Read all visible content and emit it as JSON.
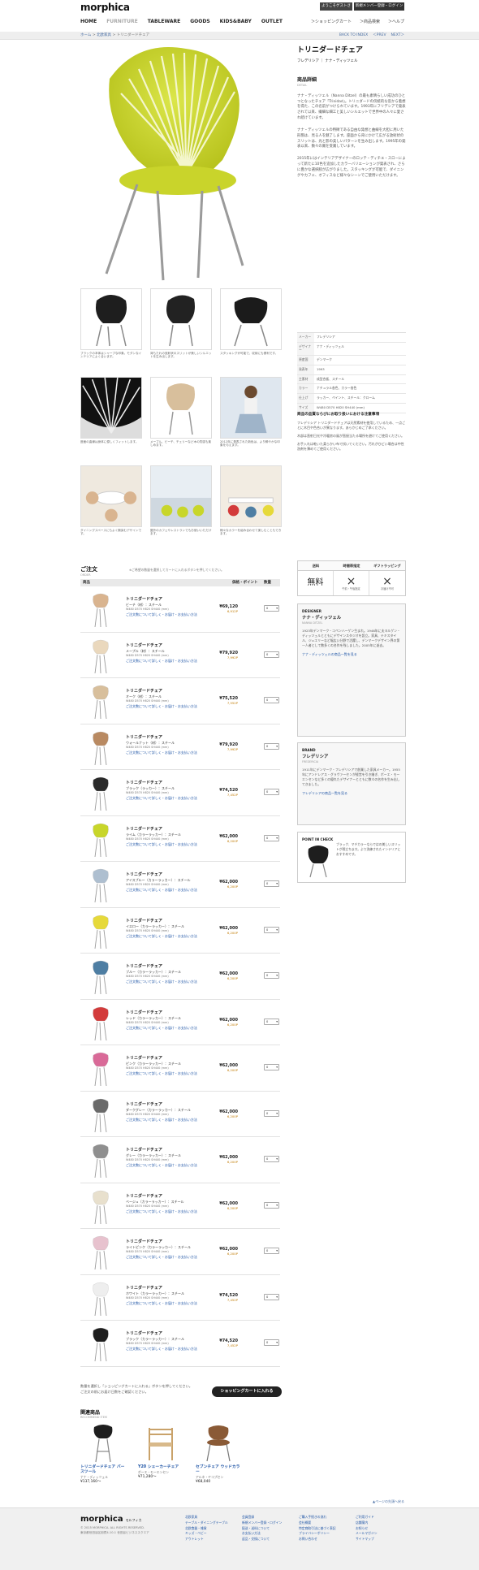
{
  "header": {
    "logo": "morphica",
    "welcome": "ようこそゲストさま",
    "member_login": "新規メンバー登録・ログイン",
    "nav": [
      "HOME",
      "FURNITURE",
      "TABLEWARE",
      "GOODS",
      "KIDS&BABY",
      "OUTLET"
    ],
    "active_nav": "FURNITURE",
    "util_nav": [
      "＞ショッピングカート",
      "＞商品検索",
      "＞ヘルプ"
    ]
  },
  "breadcrumb": {
    "items": [
      "ホーム",
      "北欧家具",
      "トリニダードチェア"
    ],
    "separator": ">",
    "pager": [
      "BACK TO INDEX",
      "＜PREV",
      "NEXT＞"
    ]
  },
  "product": {
    "title": "トリニダードチェア",
    "brand_line": "フレデリシア ｜ ナナ・ディッツェル",
    "detail_heading": "商品詳細",
    "detail_sub": "DETAIL",
    "paragraphs": [
      "ナナ・ディッツェル（Nanna Ditzel）の最も素晴らしい成功のひとつとなったチェア「Trinidad」。トリニダードの伝統的な窓から着想を得た、この名前がつけられています。1993年にフリデシアで発表されて以来、繊細な細工と美しいシルエットで世界中の人々に愛され続けています。",
      "ナナ・ディッツェルの特徴である自由な発想と曲線を大胆に用いた形態は、見る人を魅了します。座面から背にかけて広がる放射状のスリットは、光と影の美しいパターンを生み出します。1995年の発表以来、数々の賞を受賞しています。",
      "2015年にはインテリアデザイナーのロッテ・ディチエ・スローによって新たに10色を追加したカラーバリエーションが発表され、さらに豊かな選択肢が広がりました。スタッキングが可能で、ダイニングやカフェ、オフィスなど様々なシーンでご使用いただけます。"
    ],
    "thumb_captions": [
      "ブラックの本体はシャープな印象。モダンなインテリアによく合います。",
      "背もたれの放射状のスリットが美しいシルエットを生み出します。",
      "スタッキングが可能で、収納にも便利です。",
      "座面の曲線は身体に優しくフィットします。",
      "メープル、ビーチ、チェリーなど木の質感も楽しめます。",
      "2012年に発表された新色は、より鮮やかな印象を与えます。",
      "ダイニングスペースにもよく馴染むデザインです。",
      "屋外のカフェやレストランでもお使いいただけます。",
      "様々なカラーを組み合わせて楽しむこともできます。"
    ],
    "specs": [
      {
        "k": "メーカー",
        "v": "フレデリシア"
      },
      {
        "k": "デザイナー",
        "v": "ナナ・ディッツェル"
      },
      {
        "k": "原産国",
        "v": "デンマーク"
      },
      {
        "k": "発表年",
        "v": "1993"
      },
      {
        "k": "主素材",
        "v": "成型合板、スチール"
      },
      {
        "k": "カラー",
        "v": "ナチュラル各色、カラー各色"
      },
      {
        "k": "仕上げ",
        "v": "ラッカー、ペイント、スチール：クローム"
      },
      {
        "k": "サイズ",
        "v": "W480 D570 H820 SH440 (mm)"
      }
    ],
    "notes_heading": "商品の品質ならびにお取り扱いにおける注意事項",
    "notes": [
      "フレデリシア トリニダードチェアは天然素材を使用しているため、一点ごとに木目や色合いが異なります。あらかじめご了承ください。",
      "木部は直射日光や冷暖房の風が直接当たる場所を避けてご使用ください。",
      "お手入れは乾いた柔らかい布で拭いてください。汚れがひどい場合は中性洗剤を薄めてご使用ください。"
    ],
    "service": {
      "headers": [
        "送料",
        "時間帯指定",
        "ギフトラッピング"
      ],
      "values": [
        "無料",
        "×",
        "×"
      ],
      "subs": [
        "",
        "午前・午後指定",
        "お届け不可"
      ]
    },
    "designer": {
      "label": "DESIGNER",
      "name": "ナナ・ディッツェル",
      "sub": "NANNA DITZEL",
      "bio": "1923年デンマーク・コペンハーゲン生まれ。1946年に夫ヨルゲン・ディッツェルとともにデザインスタジオを設立。家具、テキスタイル、ジュエリーなど幅広い分野で活躍し、デンマークデザイン界の第一人者として数多くの名作を残しました。2005年に逝去。",
      "link": "ナナ・ディッツェルの商品一覧を見る"
    },
    "brand": {
      "label": "BRAND",
      "name": "フレデリシア",
      "sub": "FREDERICIA",
      "bio": "1911年にデンマーク・フレデリシアで創業した家具メーカー。1955年にアンドレアス・グラヴァーセンが経営を引き継ぎ、ボーエ・モーエンセンなど多くの優れたデザイナーとともに数々の名作を生み出してきました。",
      "link": "フレデリシアの商品一覧を見る"
    },
    "point": {
      "label": "POINT IN CHECK",
      "text": "ブラック、マチカラーならではの美しいスリットが際立ちます。より洗練されたインテリアにおすすめです。"
    }
  },
  "order": {
    "heading": "ご注文",
    "sub": "ORDER",
    "note": "※ご希望の数量を選択してカートに入れるボタンを押してください。",
    "columns": [
      "商品",
      "価格・ポイント",
      "数量"
    ],
    "rows": [
      {
        "name": "トリニダードチェア",
        "color": "ビーチ（材）：スチール",
        "size": "W480 D570 H820 SH440 (mm)",
        "price": "¥69,120",
        "points": "6,912P",
        "qty": "0"
      },
      {
        "name": "トリニダードチェア",
        "color": "メープル（材）：スチール",
        "size": "W480 D570 H820 SH440 (mm)",
        "price": "¥79,920",
        "points": "7,992P",
        "qty": "0"
      },
      {
        "name": "トリニダードチェア",
        "color": "オーク（材）：スチール",
        "size": "W480 D570 H820 SH440 (mm)",
        "price": "¥75,520",
        "points": "7,552P",
        "qty": "0"
      },
      {
        "name": "トリニダードチェア",
        "color": "ウォールナット（材）：スチール",
        "size": "W480 D570 H820 SH440 (mm)",
        "price": "¥79,920",
        "points": "7,992P",
        "qty": "0"
      },
      {
        "name": "トリニダードチェア",
        "color": "ブラック（ラッカー）：スチール",
        "size": "W480 D570 H820 SH440 (mm)",
        "price": "¥74,520",
        "points": "7,452P",
        "qty": "0"
      },
      {
        "name": "トリニダードチェア",
        "color": "ライム（カラーラッカー）：スチール",
        "size": "W480 D570 H820 SH440 (mm)",
        "price": "¥62,000",
        "points": "6,200P",
        "qty": "0"
      },
      {
        "name": "トリニダードチェア",
        "color": "アイスブルー（カラーラッカー）：スチール",
        "size": "W480 D570 H820 SH440 (mm)",
        "price": "¥62,000",
        "points": "6,200P",
        "qty": "0"
      },
      {
        "name": "トリニダードチェア",
        "color": "イエロー（カラーラッカー）：スチール",
        "size": "W480 D570 H820 SH440 (mm)",
        "price": "¥62,000",
        "points": "6,200P",
        "qty": "0"
      },
      {
        "name": "トリニダードチェア",
        "color": "ブルー（カラーラッカー）：スチール",
        "size": "W480 D570 H820 SH440 (mm)",
        "price": "¥62,000",
        "points": "6,200P",
        "qty": "0"
      },
      {
        "name": "トリニダードチェア",
        "color": "レッド（カラーラッカー）：スチール",
        "size": "W480 D570 H820 SH440 (mm)",
        "price": "¥62,000",
        "points": "6,200P",
        "qty": "0"
      },
      {
        "name": "トリニダードチェア",
        "color": "ピンク（カラーラッカー）：スチール",
        "size": "W480 D570 H820 SH440 (mm)",
        "price": "¥62,000",
        "points": "6,200P",
        "qty": "0"
      },
      {
        "name": "トリニダードチェア",
        "color": "ダークグレー（カラーラッカー）：スチール",
        "size": "W480 D570 H820 SH440 (mm)",
        "price": "¥62,000",
        "points": "6,200P",
        "qty": "0"
      },
      {
        "name": "トリニダードチェア",
        "color": "グレー（カラーラッカー）：スチール",
        "size": "W480 D570 H820 SH440 (mm)",
        "price": "¥62,000",
        "points": "6,200P",
        "qty": "0"
      },
      {
        "name": "トリニダードチェア",
        "color": "ベージュ（カラーラッカー）：スチール",
        "size": "W480 D570 H820 SH440 (mm)",
        "price": "¥62,000",
        "points": "6,200P",
        "qty": "0"
      },
      {
        "name": "トリニダードチェア",
        "color": "ライトピンク（カラーラッカー）：スチール",
        "size": "W480 D570 H820 SH440 (mm)",
        "price": "¥62,000",
        "points": "6,200P",
        "qty": "0"
      },
      {
        "name": "トリニダードチェア",
        "color": "ホワイト（カラーラッカー）：スチール",
        "size": "W480 D570 H820 SH440 (mm)",
        "price": "¥74,520",
        "points": "7,452P",
        "qty": "0"
      },
      {
        "name": "トリニダードチェア",
        "color": "ブラック（カラーラッカー）：スチール",
        "size": "W480 D570 H820 SH440 (mm)",
        "price": "¥74,520",
        "points": "7,452P",
        "qty": "0"
      }
    ],
    "row_link": "ご注文数について詳しく・お届け・お支払い方法",
    "row_colors": [
      "#d9b48f",
      "#ead8bd",
      "#d8bf9c",
      "#b98a62",
      "#2a2a2a",
      "#c8d62a",
      "#aebfd0",
      "#e6d93a",
      "#4e7ea3",
      "#d33b3b",
      "#d96a98",
      "#6a6a6a",
      "#8f8f8f",
      "#e8e0cd",
      "#e7c2ce",
      "#eeeeee",
      "#1e1e1e"
    ],
    "cart_note": "数量を選択し「ショッピングカートに入れる」ボタンを押してください。\nご注文の前にお届け日数をご確認ください。",
    "cart_button": "ショッピングカートに入れる"
  },
  "related": {
    "heading": "関連商品",
    "sub": "RECOMMEND ITEM",
    "items": [
      {
        "name": "トリニダードチェア バースツール",
        "brand": "ナナ・ディッツェル",
        "price": "¥137,160〜"
      },
      {
        "name": "Y20 シェーカーチェア",
        "brand": "ボーエ・モーエンセン",
        "price": "¥71,280〜"
      },
      {
        "name": "セブンチェア ウッドカラー",
        "brand": "アルネ・ヤコブセン",
        "price": "¥68,040"
      }
    ],
    "pagetop": "▲ページの先頭へ戻る"
  },
  "footer": {
    "logo": "morphica",
    "logo_sub": "モルフィカ",
    "copyright": "© 2015 MORPHICA. ALL RIGHTS RESERVED.",
    "address": "東京都世田谷区用賀4-10-1 世田谷ビジネススクエア",
    "columns": [
      [
        "北欧家具",
        "テーブル・ダイニングテーブル",
        "北欧食器・雑貨",
        "キッズ・ベビー",
        "アウトレット"
      ],
      [
        "会員登録",
        "新規メンバー登録・ログイン",
        "配送・送料について",
        "お支払い方法",
        "返品・交換について"
      ],
      [
        "ご購入手続きの流れ",
        "会社概要",
        "特定商取引法に基づく表記",
        "プライバシーポリシー",
        "お問い合わせ"
      ],
      [
        "ご利用ガイド",
        "店舗案内",
        "お知らせ",
        "メールマガジン",
        "サイトマップ"
      ]
    ]
  }
}
